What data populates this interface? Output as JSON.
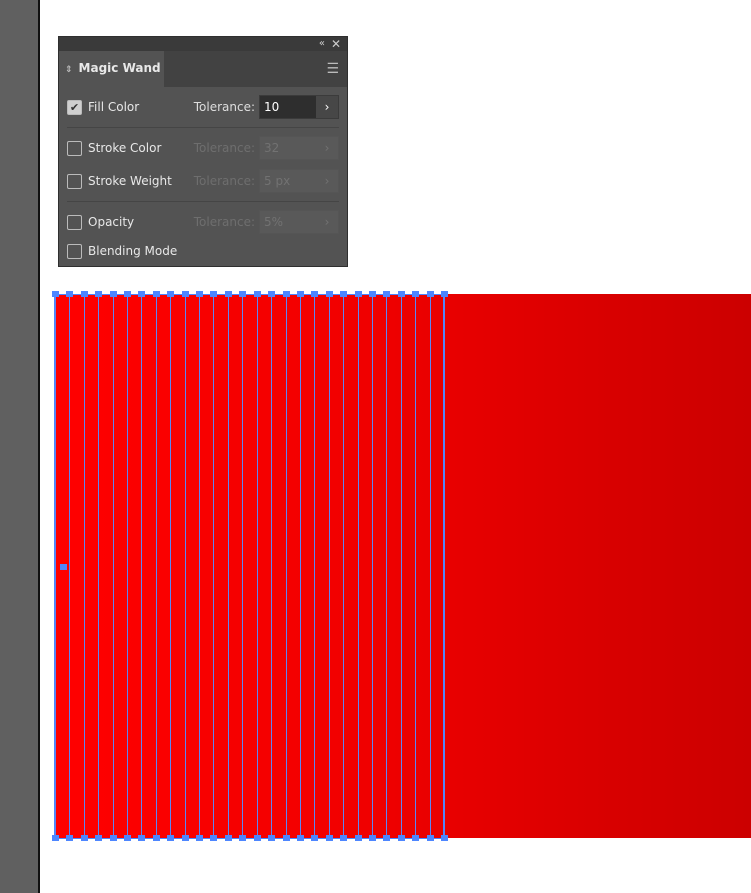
{
  "panel": {
    "title": "Magic Wand",
    "rows": [
      {
        "label": "Fill Color",
        "checked": true,
        "tolerance_label": "Tolerance:",
        "value": "10",
        "enabled": true
      },
      {
        "label": "Stroke Color",
        "checked": false,
        "tolerance_label": "Tolerance:",
        "value": "32",
        "enabled": false
      },
      {
        "label": "Stroke Weight",
        "checked": false,
        "tolerance_label": "Tolerance:",
        "value": "5 px",
        "enabled": false
      },
      {
        "label": "Opacity",
        "checked": false,
        "tolerance_label": "Tolerance:",
        "value": "5%",
        "enabled": false
      },
      {
        "label": "Blending Mode",
        "checked": false
      }
    ]
  },
  "artwork": {
    "selected_stripe_count": 27,
    "fill_color_start": "#ff0000",
    "fill_color_end": "#cc0000",
    "selection_color": "#4d86ff"
  }
}
